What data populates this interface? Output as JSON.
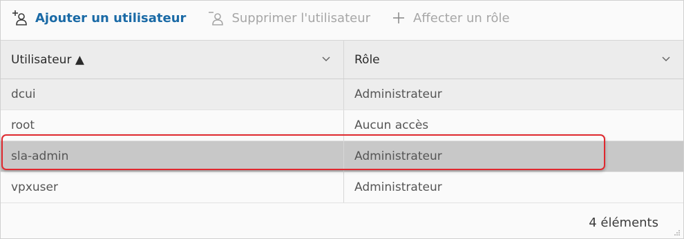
{
  "toolbar": {
    "add_user": "Ajouter un utilisateur",
    "remove_user": "Supprimer l'utilisateur",
    "assign_role": "Affecter un rôle"
  },
  "columns": {
    "user": "Utilisateur ▲",
    "role": "Rôle"
  },
  "rows": [
    {
      "user": "dcui",
      "role": "Administrateur"
    },
    {
      "user": "root",
      "role": "Aucun accès"
    },
    {
      "user": "sla-admin",
      "role": "Administrateur"
    },
    {
      "user": "vpxuser",
      "role": "Administrateur"
    }
  ],
  "footer": {
    "count": "4 éléments"
  },
  "colors": {
    "accent": "#1a6aa6",
    "highlight": "#e0282e",
    "disabled": "#a6a6a6"
  },
  "icons": {
    "add_user": "add-user-icon",
    "remove_user": "remove-user-icon",
    "assign_role": "plus-icon"
  }
}
